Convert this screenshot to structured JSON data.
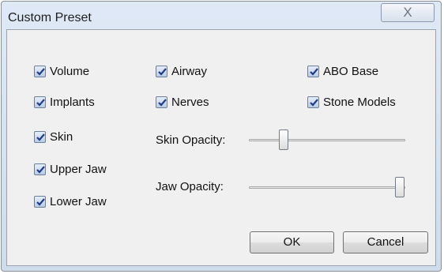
{
  "window": {
    "title": "Custom Preset",
    "close_glyph": "X"
  },
  "checkboxes": [
    {
      "label": "Volume",
      "checked": true
    },
    {
      "label": "Airway",
      "checked": true
    },
    {
      "label": "ABO Base",
      "checked": true
    },
    {
      "label": "Implants",
      "checked": true
    },
    {
      "label": "Nerves",
      "checked": true
    },
    {
      "label": "Stone Models",
      "checked": true
    },
    {
      "label": "Skin",
      "checked": true
    },
    {
      "label": "Upper Jaw",
      "checked": true
    },
    {
      "label": "Lower Jaw",
      "checked": true
    }
  ],
  "sliders": {
    "skin": {
      "label": "Skin Opacity:",
      "value": 0.22
    },
    "jaw": {
      "label": "Jaw Opacity:",
      "value": 0.97
    }
  },
  "buttons": {
    "ok": "OK",
    "cancel": "Cancel"
  },
  "colors": {
    "check": "#1f3c88",
    "title_bar": "#dfe9f6"
  }
}
